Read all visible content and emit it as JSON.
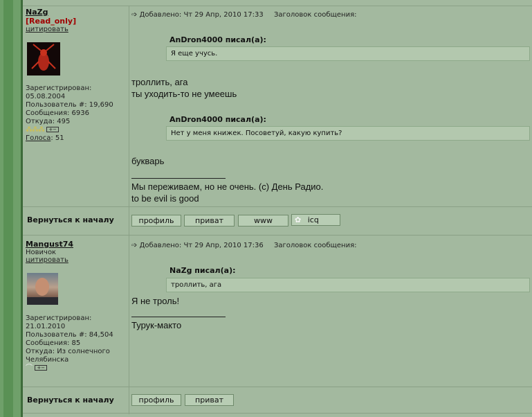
{
  "posts": [
    {
      "author": "NaZg",
      "rank": "[Read_only]",
      "quote_link": "цитировать",
      "registered_label": "Зарегистрирован:",
      "registered_date": "05.08.2004",
      "user_no": "Пользователь #: 19,690",
      "messages": "Сообщения: 6936",
      "from": "Откуда: 495",
      "votes_label": "Голоса",
      "votes_value": ": 51",
      "added": "Добавлено: Чт 29 Апр, 2010 17:33",
      "subject_label": "Заголовок сообщения:",
      "quotes": [
        {
          "author": "AnDron4000 писал(а):",
          "text": "Я еще учусь."
        },
        {
          "author": "AnDron4000 писал(а):",
          "text": "Нет у меня книжек. Посоветуй, какую купить?"
        }
      ],
      "text1": "троллить, ага",
      "text2": "ты уходить-то не умеешь",
      "text3": "букварь",
      "signature1": "Мы переживаем, но не очень. (с) День Радио.",
      "signature2": "to be evil is good",
      "back_label": "Вернуться к началу",
      "buttons": {
        "profile": "профиль",
        "pm": "приват",
        "www": "www",
        "icq": "icq"
      }
    },
    {
      "author": "Mangust74",
      "rank": "Новичок",
      "quote_link": "цитировать",
      "registered_label": "Зарегистрирован:",
      "registered_date": "21.01.2010",
      "user_no": "Пользователь #: 84,504",
      "messages": "Сообщения: 85",
      "from1": "Откуда: Из солнечного",
      "from2": "Челябинска",
      "added": "Добавлено: Чт 29 Апр, 2010 17:36",
      "subject_label": "Заголовок сообщения:",
      "quote": {
        "author": "NaZg писал(а):",
        "text": "троллить, ага"
      },
      "text1": "Я не троль!",
      "signature": "Турук-макто",
      "back_label": "Вернуться к началу",
      "buttons": {
        "profile": "профиль",
        "pm": "приват"
      }
    }
  ],
  "icons": {
    "post": "post-arrow-icon",
    "icq": "icq-flower-icon"
  }
}
